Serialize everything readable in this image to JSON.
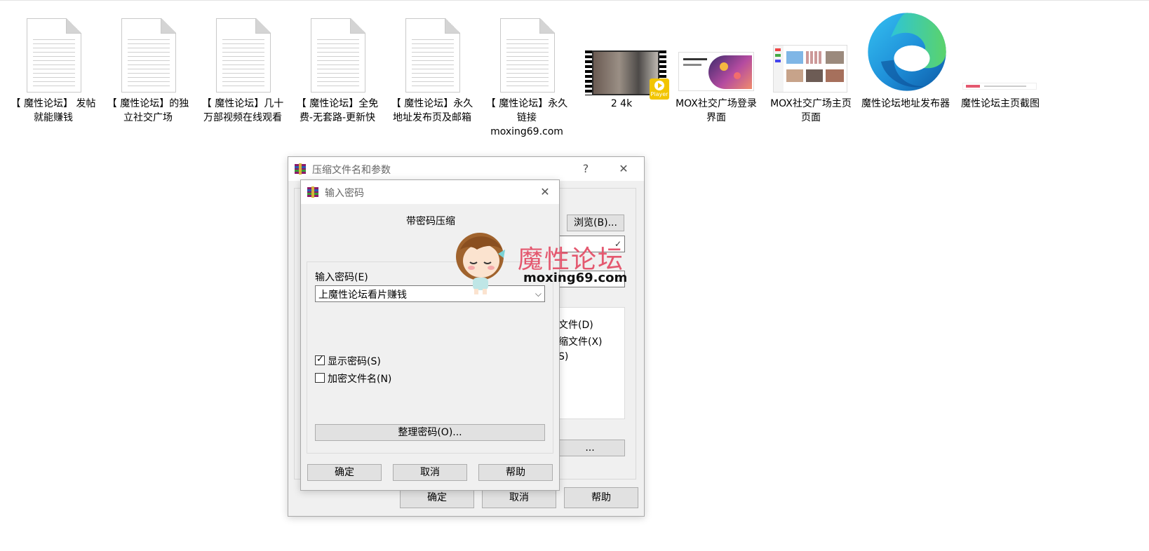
{
  "files": [
    {
      "name": "【 魔性论坛】 发帖就能赚钱",
      "kind": "document"
    },
    {
      "name": "【 魔性论坛】的独立社交广场",
      "kind": "document"
    },
    {
      "name": "【 魔性论坛】几十万部视频在线观看",
      "kind": "document"
    },
    {
      "name": "【 魔性论坛】全免费-无套路-更新快",
      "kind": "document"
    },
    {
      "name": "【 魔性论坛】永久地址发布页及邮箱",
      "kind": "document"
    },
    {
      "name": "【 魔性论坛】永久链接moxing69.com",
      "kind": "document"
    },
    {
      "name": "2 4k",
      "kind": "video",
      "badge": "Player"
    },
    {
      "name": "MOX社交广场登录界面",
      "kind": "image"
    },
    {
      "name": "MOX社交广场主页页面",
      "kind": "image"
    },
    {
      "name": "魔性论坛地址发布器",
      "kind": "edge-shortcut"
    },
    {
      "name": "魔性论坛主页截图",
      "kind": "image"
    }
  ],
  "archive_dialog": {
    "title": "压缩文件名和参数",
    "help_icon": "?",
    "close_icon": "✕",
    "browse_label": "浏览(B)...",
    "partial_items": [
      "文件(D)",
      "缩文件(X)",
      "S)"
    ],
    "partial_button": "...",
    "ok_label": "确定",
    "cancel_label": "取消",
    "help_label": "帮助"
  },
  "password_dialog": {
    "title": "输入密码",
    "close_icon": "✕",
    "heading": "带密码压缩",
    "password_label": "输入密码(E)",
    "password_value": "上魔性论坛看片赚钱",
    "show_password_label": "显示密码(S)",
    "show_password_checked": true,
    "encrypt_names_label": "加密文件名(N)",
    "encrypt_names_checked": false,
    "organize_label": "整理密码(O)...",
    "ok_label": "确定",
    "cancel_label": "取消",
    "help_label": "帮助"
  },
  "watermark": {
    "text": "魔性论坛",
    "url": "moxing69.com"
  },
  "colors": {
    "watermark": "#e4586f",
    "dialog_bg": "#f0f0f0",
    "button_bg": "#e1e1e1"
  }
}
